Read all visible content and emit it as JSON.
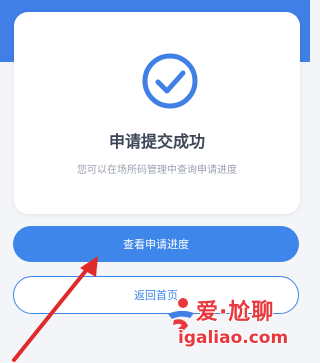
{
  "colors": {
    "accent": "#3f86ea",
    "header": "#3f7fe6",
    "annotation_arrow": "#e02a2a",
    "watermark": "#e8383d"
  },
  "success_card": {
    "icon": "check-circle-icon",
    "title": "申请提交成功",
    "subtitle": "您可以在场所码管理中查询申请进度"
  },
  "actions": {
    "primary_label": "查看申请进度",
    "secondary_label": "返回首页"
  },
  "watermark": {
    "text": "爱·尬聊",
    "domain": "igaliao.com"
  }
}
